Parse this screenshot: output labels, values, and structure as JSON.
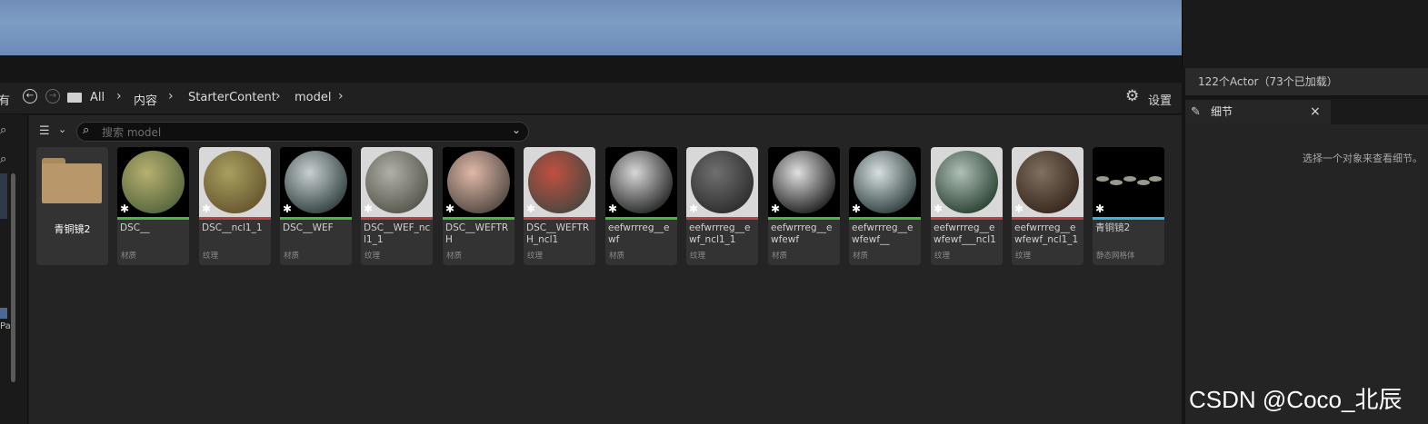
{
  "toolbar": {
    "left_cut": "有",
    "breadcrumbs": [
      "All",
      "内容",
      "StarterContent",
      "model"
    ],
    "settings_label": "设置"
  },
  "search": {
    "placeholder": "搜索 model"
  },
  "outliner": {
    "actor_count": "122个Actor（73个已加载）"
  },
  "details": {
    "tab_label": "细节",
    "close_label": "×",
    "empty_message": "选择一个对象来查看细节。"
  },
  "left_strip": {
    "cut_label": "Pa"
  },
  "watermark": "CSDN @Coco_北辰",
  "assets": [
    {
      "name": "青铜镜2",
      "type": "",
      "kind": "folder"
    },
    {
      "name": "DSC__",
      "type": "材质",
      "bar": "#48b848",
      "kind": "material",
      "c1": "#b8b070",
      "c2": "#5a6a40"
    },
    {
      "name": "DSC__ncl1_1",
      "type": "纹理",
      "bar": "#b84040",
      "kind": "texture",
      "c1": "#a8a060",
      "c2": "#6a5a30"
    },
    {
      "name": "DSC__WEF",
      "type": "材质",
      "bar": "#48b848",
      "kind": "material",
      "c1": "#c8d0d0",
      "c2": "#3a4848"
    },
    {
      "name": "DSC__WEF_ncl1_1",
      "type": "纹理",
      "bar": "#b84040",
      "kind": "texture",
      "c1": "#b0b0a8",
      "c2": "#5a5a50"
    },
    {
      "name": "DSC__WEFTRH",
      "type": "材质",
      "bar": "#48b848",
      "kind": "material",
      "c1": "#e0b8a8",
      "c2": "#5a5048"
    },
    {
      "name": "DSC__WEFTRH_ncl1",
      "type": "纹理",
      "bar": "#b84040",
      "kind": "texture",
      "c1": "#c05040",
      "c2": "#504840"
    },
    {
      "name": "eefwrrreg__ewf",
      "type": "材质",
      "bar": "#48b848",
      "kind": "material",
      "c1": "#d8d8d8",
      "c2": "#303030"
    },
    {
      "name": "eefwrrreg__ewf_ncl1_1",
      "type": "纹理",
      "bar": "#b84040",
      "kind": "texture",
      "c1": "#707070",
      "c2": "#303030"
    },
    {
      "name": "eefwrrreg__ewfewf",
      "type": "材质",
      "bar": "#48b848",
      "kind": "material",
      "c1": "#e0e0e0",
      "c2": "#2a2a2a"
    },
    {
      "name": "eefwrrreg__ewfewf__",
      "type": "材质",
      "bar": "#48b848",
      "kind": "material",
      "c1": "#d8e0e0",
      "c2": "#384848"
    },
    {
      "name": "eefwrrreg__ewfewf___ncl1",
      "type": "纹理",
      "bar": "#b84040",
      "kind": "texture",
      "c1": "#b0c0b8",
      "c2": "#304838"
    },
    {
      "name": "eefwrrreg__ewfewf_ncl1_1",
      "type": "纹理",
      "bar": "#b84040",
      "kind": "texture",
      "c1": "#807060",
      "c2": "#3a2a20"
    },
    {
      "name": "青铜镜2",
      "type": "静态网格体",
      "bar": "#38b8d8",
      "kind": "mesh"
    }
  ]
}
